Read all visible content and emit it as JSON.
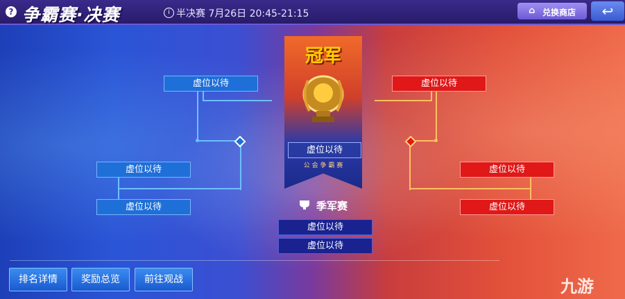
{
  "header": {
    "help_icon": "?",
    "title": "争霸赛·决赛",
    "schedule": "半决赛 7月26日 20:45-21:15",
    "shop_label": "兑换商店",
    "back_icon": "↩"
  },
  "bracket": {
    "left_top": "虚位以待",
    "left_mid1": "虚位以待",
    "left_mid2": "虚位以待",
    "right_top": "虚位以待",
    "right_mid1": "虚位以待",
    "right_mid2": "虚位以待",
    "center_top": "虚位以待",
    "third1": "虚位以待",
    "third2": "虚位以待"
  },
  "banner": {
    "title": "冠军",
    "subtitle": "公 会 争 霸 赛"
  },
  "third_place_label": "季军赛",
  "buttons": {
    "ranking": "排名详情",
    "rewards": "奖励总览",
    "watch": "前往观战"
  },
  "watermark": "九游",
  "colors": {
    "left_team": "#1f6fd8",
    "right_team": "#e01818",
    "third_place": "#1a2290",
    "gold": "#ffd000"
  }
}
